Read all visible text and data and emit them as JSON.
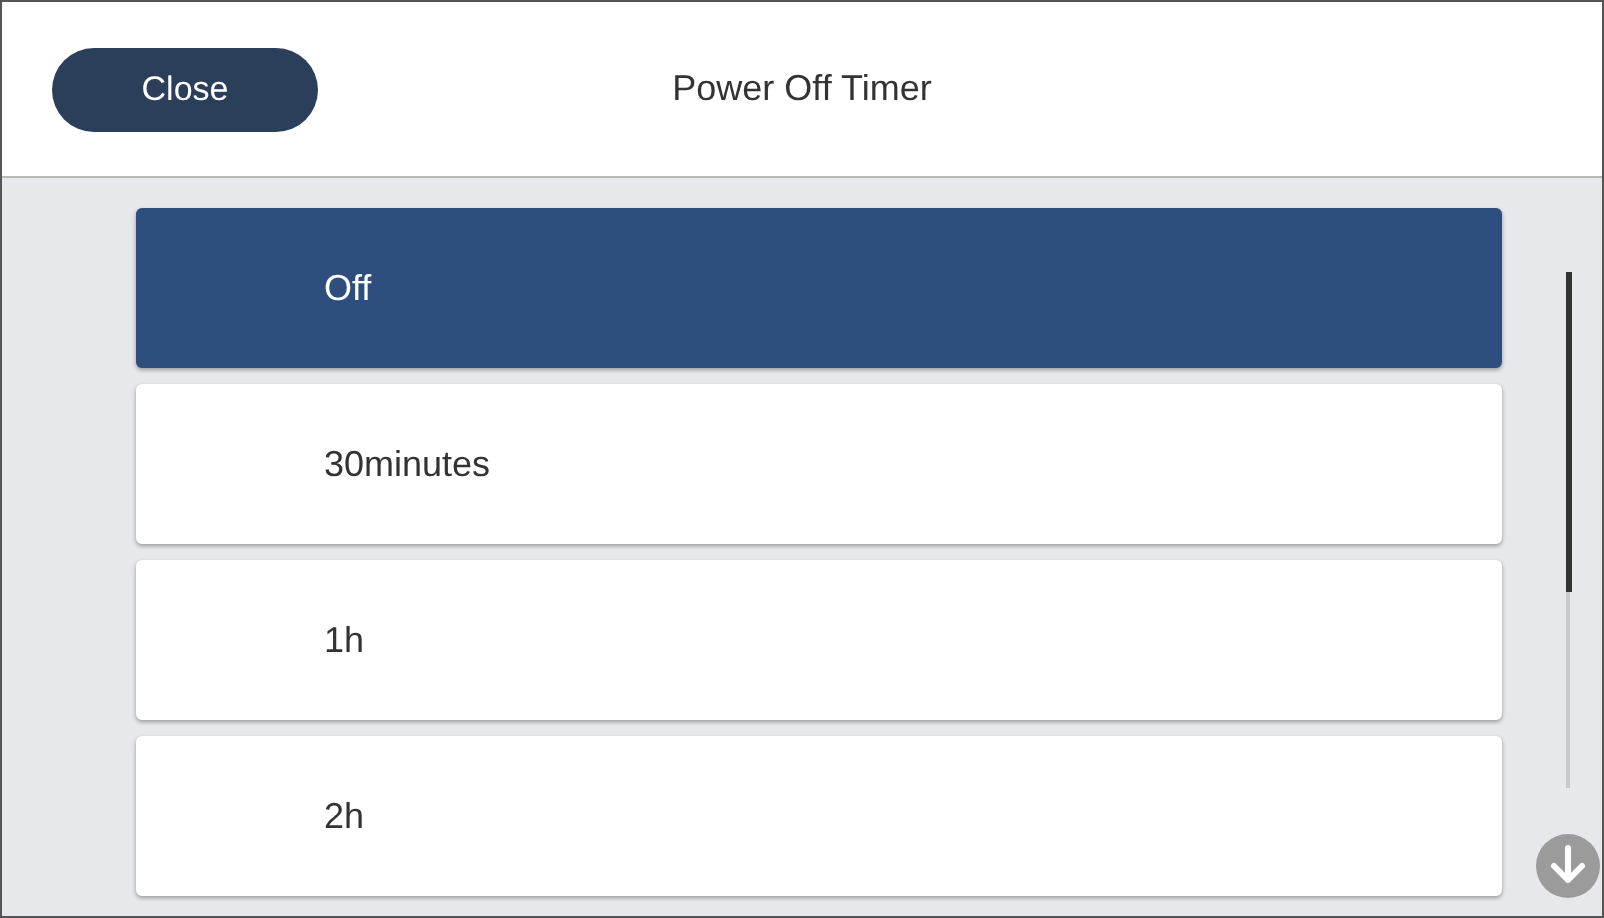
{
  "header": {
    "close_button": "Close",
    "title": "Power Off Timer"
  },
  "options": [
    {
      "label": "Off",
      "selected": true
    },
    {
      "label": "30minutes",
      "selected": false
    },
    {
      "label": "1h",
      "selected": false
    },
    {
      "label": "2h",
      "selected": false
    }
  ]
}
